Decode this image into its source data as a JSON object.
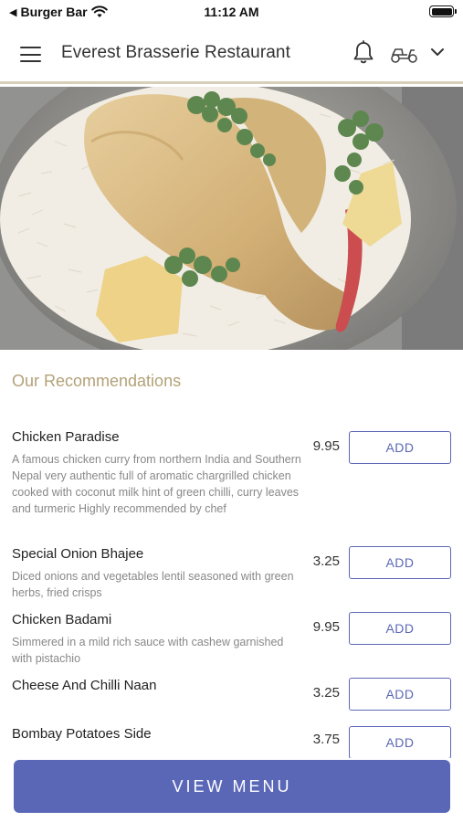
{
  "status_bar": {
    "back_app": "Burger Bar",
    "time": "11:12 AM"
  },
  "header": {
    "title": "Everest Brasserie Restaurant",
    "icons": [
      "menu-icon",
      "bell-icon",
      "scooter-icon",
      "chevron-down-icon"
    ]
  },
  "hero": {
    "image": "chicken-rice-dish"
  },
  "recommendations": {
    "title": "Our Recommendations",
    "items": [
      {
        "name": "Chicken Paradise",
        "description": "A famous chicken curry from northern India and Southern Nepal very authentic full of aromatic chargrilled chicken cooked with coconut milk hint of green chilli, curry leaves and turmeric Highly recommended by chef",
        "price": "9.95",
        "button": "ADD"
      },
      {
        "name": "Special Onion Bhajee",
        "description": "Diced onions and vegetables lentil seasoned with green herbs, fried crisps",
        "price": "3.25",
        "button": "ADD"
      },
      {
        "name": "Chicken Badami",
        "description": "Simmered in a mild rich sauce with cashew garnished with pistachio",
        "price": "9.95",
        "button": "ADD"
      },
      {
        "name": "Cheese And Chilli Naan",
        "description": "",
        "price": "3.25",
        "button": "ADD"
      },
      {
        "name": "Bombay Potatoes Side",
        "description": "",
        "price": "3.75",
        "button": "ADD"
      }
    ]
  },
  "footer": {
    "view_menu_label": "VIEW MENU"
  },
  "colors": {
    "accent": "#5a67b7",
    "section_title": "#b3a278",
    "description_text": "#888888"
  }
}
